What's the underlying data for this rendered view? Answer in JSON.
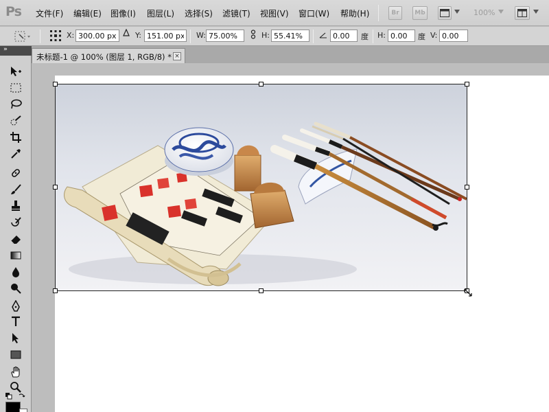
{
  "app": {
    "logo": "Ps",
    "menus": [
      "文件(F)",
      "编辑(E)",
      "图像(I)",
      "图层(L)",
      "选择(S)",
      "滤镜(T)",
      "视图(V)",
      "窗口(W)",
      "帮助(H)"
    ],
    "bridge_label": "Br",
    "minibridge_label": "Mb",
    "zoom_display": "100%"
  },
  "options": {
    "x_label": "X:",
    "x_value": "300.00 px",
    "y_label": "Y:",
    "y_value": "151.00 px",
    "w_label": "W:",
    "w_value": "75.00%",
    "h_label": "H:",
    "h_value": "55.41%",
    "rotate_value": "0.00",
    "rotate_unit": "度",
    "skew_h_label": "H:",
    "skew_h_value": "0.00",
    "skew_h_unit": "度",
    "skew_v_label": "V:",
    "skew_v_value": "0.00"
  },
  "document": {
    "tab_title": "未标题-1 @ 100% (图层 1, RGB/8) *",
    "close_glyph": "×"
  },
  "tools": [
    "move-icon",
    "marquee-icon",
    "lasso-icon",
    "quick-select-icon",
    "crop-icon",
    "eyedropper-icon",
    "healing-brush-icon",
    "brush-icon",
    "clone-stamp-icon",
    "history-brush-icon",
    "eraser-icon",
    "gradient-icon",
    "blur-icon",
    "dodge-icon",
    "pen-icon",
    "type-icon",
    "path-select-icon",
    "rectangle-icon",
    "hand-icon",
    "zoom-icon"
  ],
  "photo": {
    "subject": "Chinese calligraphy set: brushes, seals, ink paste box, scroll with seal impressions"
  }
}
